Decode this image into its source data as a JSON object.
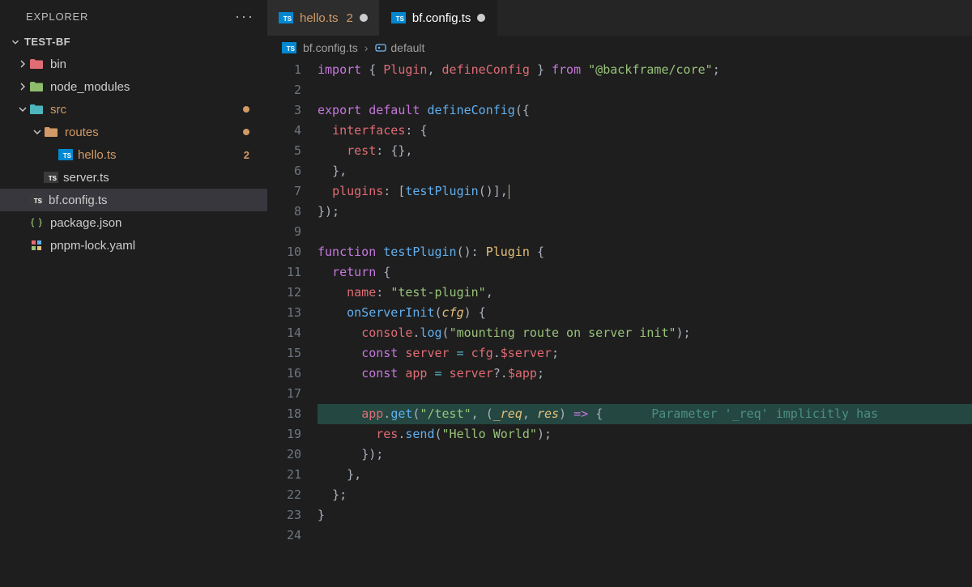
{
  "explorer": {
    "title": "EXPLORER",
    "section": "TEST-BF",
    "items": [
      {
        "label": "bin",
        "kind": "folder",
        "color": "red",
        "indent": 1,
        "expanded": false
      },
      {
        "label": "node_modules",
        "kind": "folder",
        "color": "green",
        "indent": 1,
        "expanded": false
      },
      {
        "label": "src",
        "kind": "folder",
        "color": "teal",
        "indent": 1,
        "expanded": true,
        "badge": "dot",
        "labelColor": "#d19a66"
      },
      {
        "label": "routes",
        "kind": "folder",
        "color": "orange",
        "indent": 2,
        "expanded": true,
        "badge": "dot",
        "labelColor": "#d19a66"
      },
      {
        "label": "hello.ts",
        "kind": "ts",
        "indent": 3,
        "badge": "2",
        "labelColor": "#d19a66"
      },
      {
        "label": "server.ts",
        "kind": "ts-dark",
        "indent": 2
      },
      {
        "label": "bf.config.ts",
        "kind": "ts-dark",
        "indent": 1,
        "selected": true
      },
      {
        "label": "package.json",
        "kind": "json",
        "indent": 1
      },
      {
        "label": "pnpm-lock.yaml",
        "kind": "yaml",
        "indent": 1
      }
    ]
  },
  "tabs": [
    {
      "label": "hello.ts",
      "modified": true,
      "badge": "2",
      "dirty": true,
      "active": false
    },
    {
      "label": "bf.config.ts",
      "modified": false,
      "dirty": true,
      "active": true
    }
  ],
  "breadcrumb": {
    "file": "bf.config.ts",
    "symbol": "default"
  },
  "code": {
    "lines": [
      {
        "n": 1,
        "html": "<span class='tok-kw'>import</span> <span class='tok-pun'>{</span> <span class='tok-var'>Plugin</span><span class='tok-pun'>,</span> <span class='tok-var'>defineConfig</span> <span class='tok-pun'>}</span> <span class='tok-kw'>from</span> <span class='tok-str'>\"@backframe/core\"</span><span class='tok-pun'>;</span>"
      },
      {
        "n": 2,
        "html": ""
      },
      {
        "n": 3,
        "html": "<span class='tok-kw'>export</span> <span class='tok-kw'>default</span> <span class='tok-fn'>defineConfig</span><span class='tok-pun'>({</span>"
      },
      {
        "n": 4,
        "html": "  <span class='tok-prop'>interfaces</span><span class='tok-pun'>:</span> <span class='tok-pun'>{</span>"
      },
      {
        "n": 5,
        "html": "    <span class='tok-prop'>rest</span><span class='tok-pun'>:</span> <span class='tok-pun'>{},</span>"
      },
      {
        "n": 6,
        "html": "  <span class='tok-pun'>},</span>"
      },
      {
        "n": 7,
        "html": "  <span class='tok-prop'>plugins</span><span class='tok-pun'>:</span> <span class='tok-pun'>[</span><span class='tok-fn'>testPlugin</span><span class='tok-pun'>()],</span><span class='cursor-bar'></span>"
      },
      {
        "n": 8,
        "html": "<span class='tok-pun'>});</span>"
      },
      {
        "n": 9,
        "html": ""
      },
      {
        "n": 10,
        "html": "<span class='tok-kw'>function</span> <span class='tok-fn'>testPlugin</span><span class='tok-pun'>():</span> <span class='tok-type'>Plugin</span> <span class='tok-pun'>{</span>"
      },
      {
        "n": 11,
        "html": "  <span class='tok-kw'>return</span> <span class='tok-pun'>{</span>"
      },
      {
        "n": 12,
        "html": "    <span class='tok-prop'>name</span><span class='tok-pun'>:</span> <span class='tok-str'>\"test-plugin\"</span><span class='tok-pun'>,</span>"
      },
      {
        "n": 13,
        "html": "    <span class='tok-fn'>onServerInit</span><span class='tok-pun'>(</span><span class='tok-param'>cfg</span><span class='tok-pun'>)</span> <span class='tok-pun'>{</span>"
      },
      {
        "n": 14,
        "html": "      <span class='tok-var'>console</span><span class='tok-pun'>.</span><span class='tok-fn'>log</span><span class='tok-pun'>(</span><span class='tok-str'>\"mounting route on server init\"</span><span class='tok-pun'>);</span>"
      },
      {
        "n": 15,
        "html": "      <span class='tok-kw'>const</span> <span class='tok-var'>server</span> <span class='tok-op'>=</span> <span class='tok-var'>cfg</span><span class='tok-pun'>.</span><span class='tok-var'>$server</span><span class='tok-pun'>;</span>"
      },
      {
        "n": 16,
        "html": "      <span class='tok-kw'>const</span> <span class='tok-var'>app</span> <span class='tok-op'>=</span> <span class='tok-var'>server</span><span class='tok-pun'>?.</span><span class='tok-var'>$app</span><span class='tok-pun'>;</span>"
      },
      {
        "n": 17,
        "html": ""
      },
      {
        "n": 18,
        "hl": true,
        "html": "      <span class='tok-var'>app</span><span class='tok-pun'>.</span><span class='tok-fn'>get</span><span class='tok-pun'>(</span><span class='tok-str'>\"/test\"</span><span class='tok-pun'>,</span> <span class='tok-pun'>(</span><span class='tok-param'>_req</span><span class='tok-pun'>,</span> <span class='tok-param'>res</span><span class='tok-pun'>)</span> <span class='tok-kw'>=&gt;</span> <span class='tok-pun'>{</span><span class='inline-err'>Parameter '_req' implicitly has</span>"
      },
      {
        "n": 19,
        "html": "        <span class='tok-var'>res</span><span class='tok-pun'>.</span><span class='tok-fn'>send</span><span class='tok-pun'>(</span><span class='tok-str'>\"Hello World\"</span><span class='tok-pun'>);</span>"
      },
      {
        "n": 20,
        "html": "      <span class='tok-pun'>});</span>"
      },
      {
        "n": 21,
        "html": "    <span class='tok-pun'>},</span>"
      },
      {
        "n": 22,
        "html": "  <span class='tok-pun'>};</span>"
      },
      {
        "n": 23,
        "html": "<span class='tok-pun'>}</span>"
      },
      {
        "n": 24,
        "html": ""
      }
    ]
  }
}
